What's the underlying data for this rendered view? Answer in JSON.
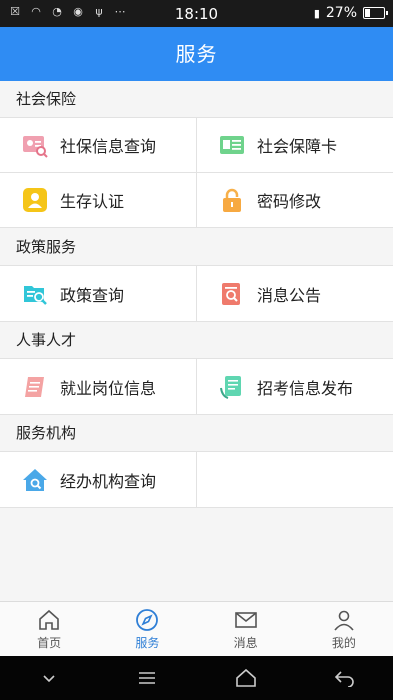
{
  "status": {
    "time": "18:10",
    "battery": "27%",
    "battery_level": 0.27,
    "left_icons": [
      "close-box-icon",
      "wifi-icon",
      "wifi-question-icon",
      "cat-icon",
      "usb-icon",
      "more-dots-icon"
    ]
  },
  "header": {
    "title": "服务"
  },
  "sections": [
    {
      "title": "社会保险",
      "items": [
        "社保信息查询",
        "社会保障卡",
        "生存认证",
        "密码修改"
      ]
    },
    {
      "title": "政策服务",
      "items": [
        "政策查询",
        "消息公告"
      ]
    },
    {
      "title": "人事人才",
      "items": [
        "就业岗位信息",
        "招考信息发布"
      ]
    },
    {
      "title": "服务机构",
      "items": [
        "经办机构查询"
      ]
    }
  ],
  "bottom_nav": [
    {
      "label": "首页",
      "icon": "home-icon",
      "active": false
    },
    {
      "label": "服务",
      "icon": "compass-icon",
      "active": true
    },
    {
      "label": "消息",
      "icon": "mail-icon",
      "active": false
    },
    {
      "label": "我的",
      "icon": "person-icon",
      "active": false
    }
  ],
  "colors": {
    "accent": "#2f8cf3",
    "active_tab": "#2f7fd6"
  }
}
